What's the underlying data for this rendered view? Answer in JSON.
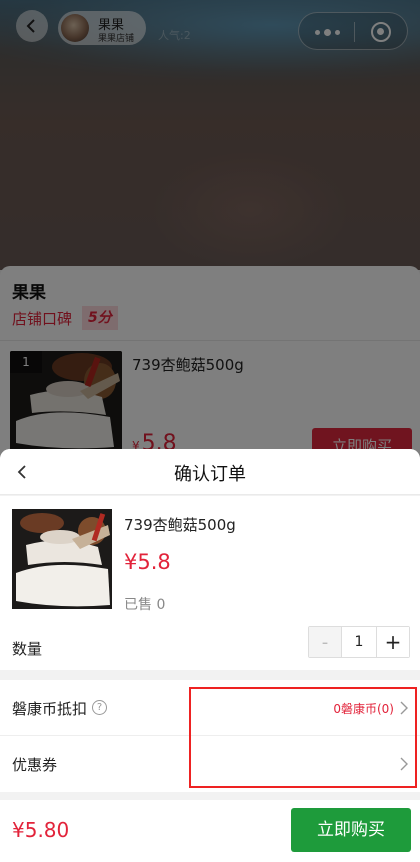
{
  "topbar": {
    "shop_name": "果果",
    "shop_subtitle": "果果店铺",
    "popularity": "人气:2"
  },
  "store": {
    "title": "果果",
    "rating_label": "店铺口碑",
    "rating_score": "5分",
    "list_item": {
      "rank": "1",
      "name": "739杏鲍菇500g",
      "price_symbol": "¥",
      "price": "5.8",
      "buy_label": "立即购买"
    }
  },
  "order": {
    "title": "确认订单",
    "product": {
      "name": "739杏鲍菇500g",
      "price": "¥5.8",
      "sold": "已售 0"
    },
    "quantity": {
      "label": "数量",
      "minus": "-",
      "value": "1",
      "plus": "+"
    },
    "options": {
      "coin_label": "磐康币抵扣",
      "coin_help": "?",
      "coin_value": "0磐康币(0)",
      "coupon_label": "优惠券"
    },
    "footer": {
      "total": "¥5.80",
      "buy_label": "立即购买"
    }
  },
  "colors": {
    "price_red": "#e2233a",
    "buy_green": "#1e9b3b",
    "highlight_red": "#e22222"
  }
}
